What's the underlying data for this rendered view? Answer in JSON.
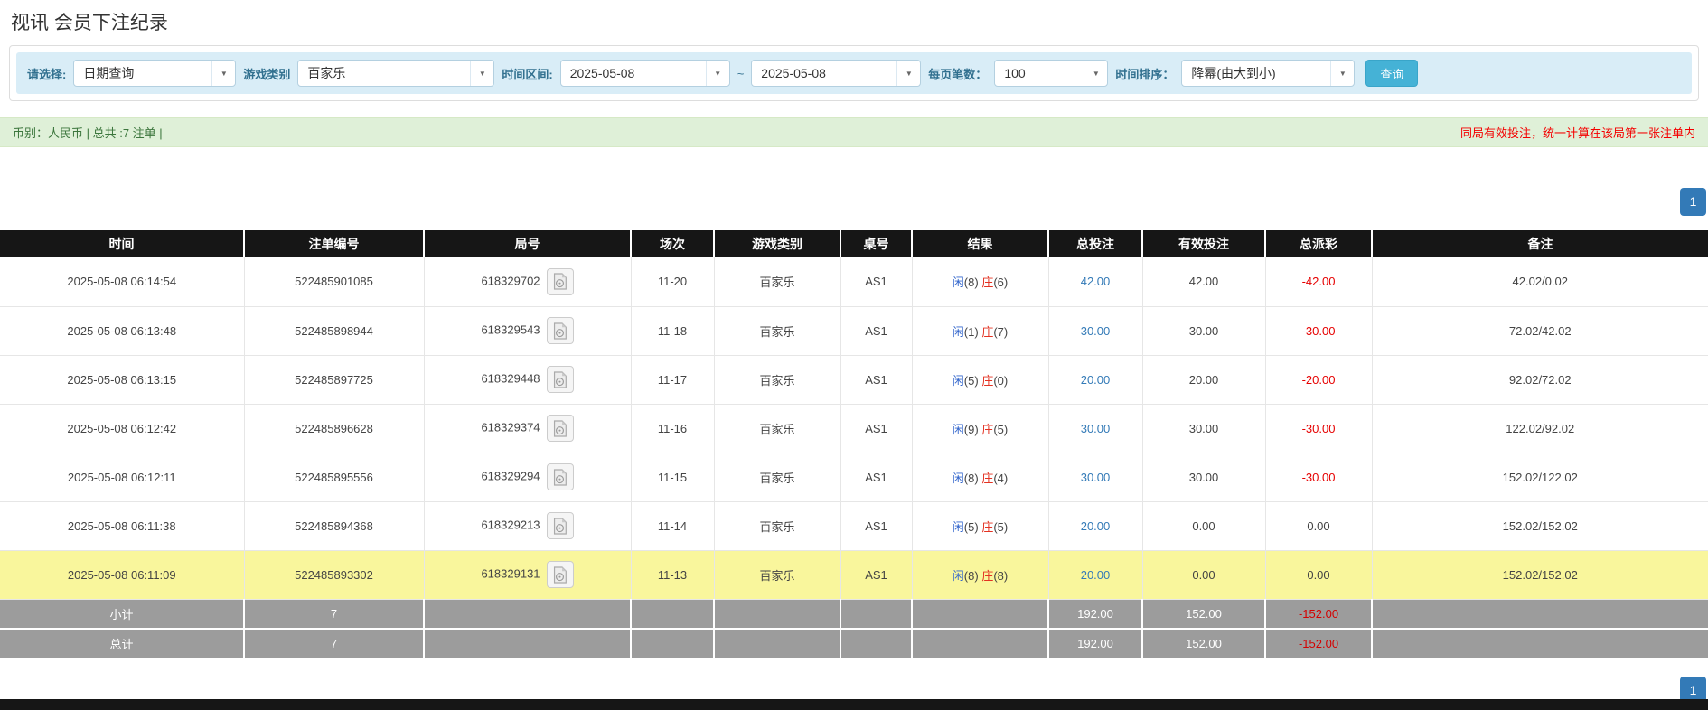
{
  "page": {
    "title": "视讯 会员下注纪录"
  },
  "icons": {
    "chevron_down": "▼",
    "video": "video-file-icon"
  },
  "colors": {
    "filter_bar_bg": "#d9edf7",
    "label_blue": "#31708f",
    "search_btn_blue": "#45b2d6",
    "summary_bg": "#dff0d8",
    "summary_green": "#3c763d",
    "note_red": "#f40000",
    "header_bg": "#161616",
    "pagination_blue": "#337ab7",
    "link_blue": "#337ab7",
    "player_blue": "#3366cc",
    "banker_red": "#e33222",
    "negative_red": "#e60000",
    "highlight_yellow": "#f9f69c",
    "subtotal_gray": "#9c9c9c"
  },
  "filters": {
    "query_type_label": "请选择:",
    "query_type_value": "日期查询",
    "game_label": "游戏类别",
    "game_value": "百家乐",
    "range_label": "时间区间:",
    "date_from": "2025-05-08",
    "tilde": "~",
    "date_to": "2025-05-08",
    "page_size_label": "每页笔数：",
    "page_size_value": "100",
    "sort_label": "时间排序：",
    "sort_value": "降幂(由大到小)",
    "search_button": "查询"
  },
  "summary": {
    "left_text": "币别：人民币 | 总共 :7 注单 |",
    "right_note": "同局有效投注，统一计算在该局第一张注单内"
  },
  "pagination": {
    "page": "1"
  },
  "table": {
    "headers": [
      "时间",
      "注单编号",
      "局号",
      "场次",
      "游戏类别",
      "桌号",
      "结果",
      "总投注",
      "有效投注",
      "总派彩",
      "备注"
    ],
    "rows": [
      {
        "time": "2025-05-08 06:14:54",
        "bet_id": "522485901085",
        "round_id": "618329702",
        "session": "11-20",
        "game": "百家乐",
        "table_no": "AS1",
        "result": {
          "player_label": "闲",
          "player_score": "(8)",
          "banker_label": "庄",
          "banker_score": "(6)"
        },
        "total_bet": "42.00",
        "valid_bet": "42.00",
        "payout": "-42.00",
        "note": "42.02/0.02",
        "highlighted": false
      },
      {
        "time": "2025-05-08 06:13:48",
        "bet_id": "522485898944",
        "round_id": "618329543",
        "session": "11-18",
        "game": "百家乐",
        "table_no": "AS1",
        "result": {
          "player_label": "闲",
          "player_score": "(1)",
          "banker_label": "庄",
          "banker_score": "(7)"
        },
        "total_bet": "30.00",
        "valid_bet": "30.00",
        "payout": "-30.00",
        "note": "72.02/42.02",
        "highlighted": false
      },
      {
        "time": "2025-05-08 06:13:15",
        "bet_id": "522485897725",
        "round_id": "618329448",
        "session": "11-17",
        "game": "百家乐",
        "table_no": "AS1",
        "result": {
          "player_label": "闲",
          "player_score": "(5)",
          "banker_label": "庄",
          "banker_score": "(0)"
        },
        "total_bet": "20.00",
        "valid_bet": "20.00",
        "payout": "-20.00",
        "note": "92.02/72.02",
        "highlighted": false
      },
      {
        "time": "2025-05-08 06:12:42",
        "bet_id": "522485896628",
        "round_id": "618329374",
        "session": "11-16",
        "game": "百家乐",
        "table_no": "AS1",
        "result": {
          "player_label": "闲",
          "player_score": "(9)",
          "banker_label": "庄",
          "banker_score": "(5)"
        },
        "total_bet": "30.00",
        "valid_bet": "30.00",
        "payout": "-30.00",
        "note": "122.02/92.02",
        "highlighted": false
      },
      {
        "time": "2025-05-08 06:12:11",
        "bet_id": "522485895556",
        "round_id": "618329294",
        "session": "11-15",
        "game": "百家乐",
        "table_no": "AS1",
        "result": {
          "player_label": "闲",
          "player_score": "(8)",
          "banker_label": "庄",
          "banker_score": "(4)"
        },
        "total_bet": "30.00",
        "valid_bet": "30.00",
        "payout": "-30.00",
        "note": "152.02/122.02",
        "highlighted": false
      },
      {
        "time": "2025-05-08 06:11:38",
        "bet_id": "522485894368",
        "round_id": "618329213",
        "session": "11-14",
        "game": "百家乐",
        "table_no": "AS1",
        "result": {
          "player_label": "闲",
          "player_score": "(5)",
          "banker_label": "庄",
          "banker_score": "(5)"
        },
        "total_bet": "20.00",
        "valid_bet": "0.00",
        "payout": "0.00",
        "note": "152.02/152.02",
        "highlighted": false
      },
      {
        "time": "2025-05-08 06:11:09",
        "bet_id": "522485893302",
        "round_id": "618329131",
        "session": "11-13",
        "game": "百家乐",
        "table_no": "AS1",
        "result": {
          "player_label": "闲",
          "player_score": "(8)",
          "banker_label": "庄",
          "banker_score": "(8)"
        },
        "total_bet": "20.00",
        "valid_bet": "0.00",
        "payout": "0.00",
        "note": "152.02/152.02",
        "highlighted": true
      }
    ],
    "subtotal_row": {
      "label": "小计",
      "count": "7",
      "total_bet": "192.00",
      "valid_bet": "152.00",
      "payout": "-152.00"
    },
    "total_row": {
      "label": "总计",
      "count": "7",
      "total_bet": "192.00",
      "valid_bet": "152.00",
      "payout": "-152.00"
    }
  }
}
